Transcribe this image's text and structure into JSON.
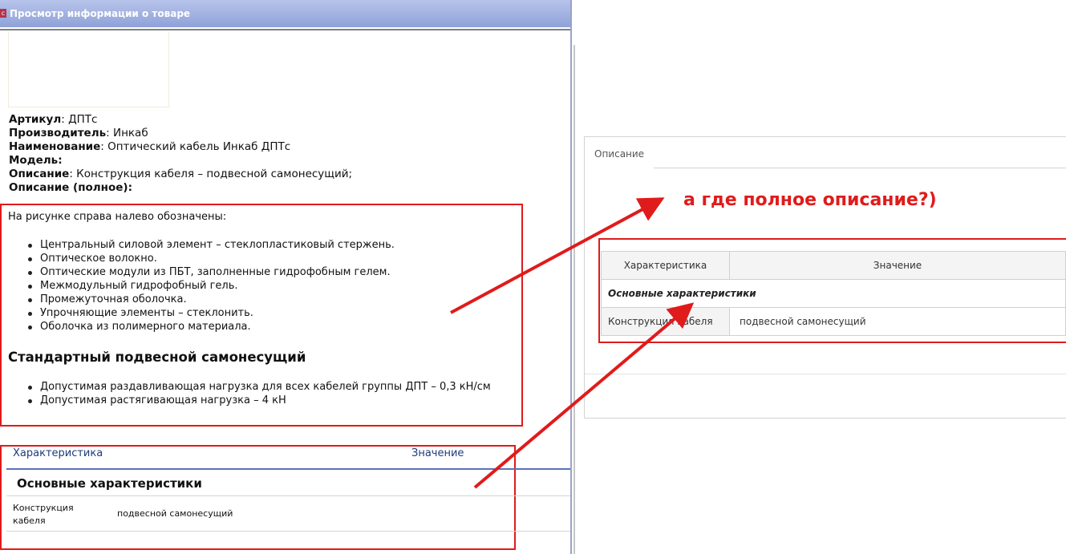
{
  "window": {
    "title": "Просмотр информации о товаре",
    "icon": "app-icon"
  },
  "product": {
    "fields": [
      {
        "label": "Артикул",
        "value": "ДПТс"
      },
      {
        "label": "Производитель",
        "value": "Инкаб"
      },
      {
        "label": "Наименование",
        "value": "Оптический кабель Инкаб ДПТс"
      },
      {
        "label": "Модель",
        "value": ""
      },
      {
        "label": "Описание",
        "value": "Конструкция кабеля – подвесной самонесущий;"
      },
      {
        "label": "Описание (полное)",
        "value": ""
      }
    ],
    "full_description": {
      "intro": "На рисунке справа налево обозначены:",
      "bullets": [
        "Центральный силовой элемент – стеклопластиковый стержень.",
        "Оптическое волокно.",
        "Оптические модули из ПБТ, заполненные гидрофобным гелем.",
        "Межмодульный гидрофобный гель.",
        "Промежуточная оболочка.",
        "Упрочняющие элементы – стеклонить.",
        "Оболочка из полимерного материала."
      ],
      "subheading": "Стандартный подвесной самонесущий",
      "bullets2": [
        "Допустимая раздавливающая нагрузка для всех кабелей группы ДПТ – 0,3 кН/см",
        "Допустимая растягивающая нагрузка – 4 кН"
      ]
    },
    "spec_table": {
      "headers": [
        "Характеристика",
        "Значение"
      ],
      "group": "Основные характеристики",
      "rows": [
        {
          "name": "Конструкция кабеля",
          "value": "подвесной самонесущий"
        }
      ]
    }
  },
  "right_panel": {
    "tab_label": "Описание",
    "spec_table": {
      "headers": [
        "Характеристика",
        "Значение"
      ],
      "group": "Основные характеристики",
      "rows": [
        {
          "name": "Конструкция кабеля",
          "value": "подвесной самонесущий"
        }
      ]
    }
  },
  "annotation": {
    "text": "а где полное описание?)",
    "color": "#e01b1b"
  }
}
